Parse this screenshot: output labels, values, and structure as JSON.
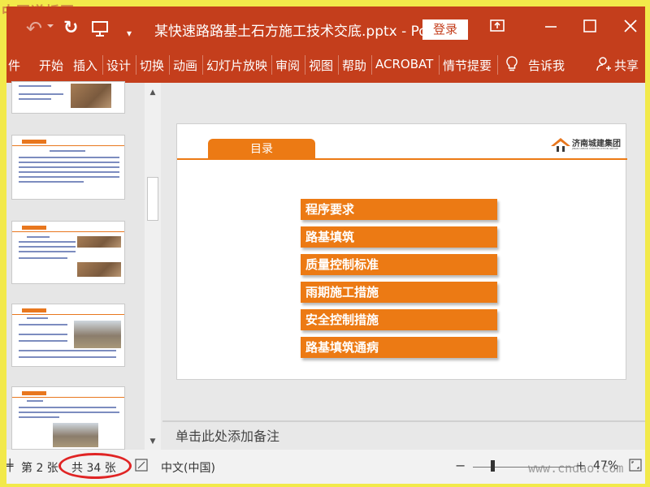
{
  "watermark": {
    "top": "中国道桥网",
    "bottom": "www.cndao.com"
  },
  "titlebar": {
    "doc_title": "某快速路路基土石方施工技术交底.pptx  -  Po...",
    "login_label": "登录"
  },
  "ribbon": {
    "tabs": [
      "件",
      "开始",
      "插入",
      "设计",
      "切换",
      "动画",
      "幻灯片放映",
      "审阅",
      "视图",
      "帮助",
      "ACROBAT",
      "情节提要",
      "告诉我",
      "共享"
    ]
  },
  "slide": {
    "tab_title": "目录",
    "logo_name": "济南城建集团",
    "logo_sub": "JINAN URBAN CONSTRUCTION GROUP",
    "toc": [
      "程序要求",
      "路基填筑",
      "质量控制标准",
      "雨期施工措施",
      "安全控制措施",
      "路基填筑通病"
    ]
  },
  "notes": {
    "placeholder": "单击此处添加备注"
  },
  "status": {
    "slide_num": "第 2 张",
    "total": "共 34 张",
    "language": "中文(中国)",
    "zoom": "47%"
  }
}
